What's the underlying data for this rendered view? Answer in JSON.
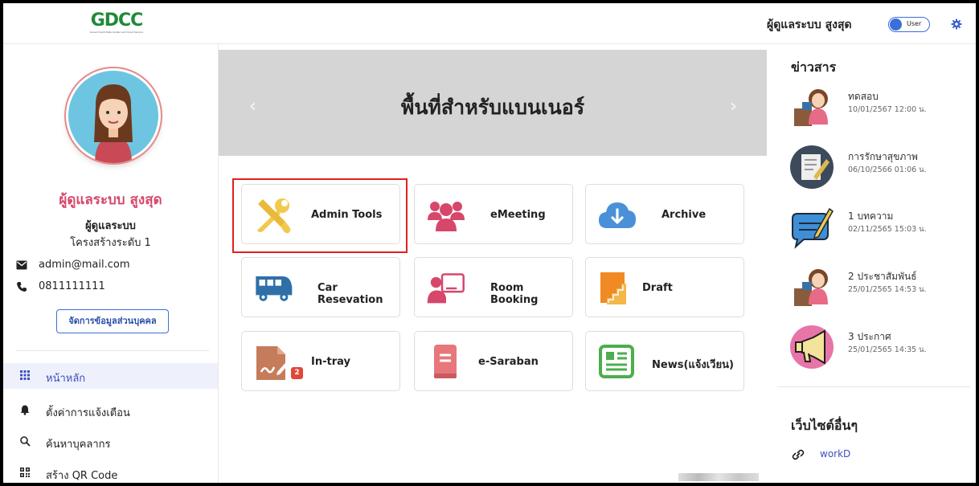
{
  "header": {
    "logo_text": "GDCC",
    "logo_subtext": "Government Data Center and Cloud Service",
    "user_name": "ผู้ดูแลระบบ สูงสุด",
    "mode_toggle_label": "User",
    "settings_icon": "gear-icon"
  },
  "profile": {
    "name": "ผู้ดูแลระบบ สูงสุด",
    "role": "ผู้ดูแลระบบ",
    "level": "โครงสร้างระดับ 1",
    "email": "admin@mail.com",
    "phone": "0811111111",
    "manage_button": "จัดการข้อมูลส่วนบุคคล"
  },
  "nav": {
    "items": [
      {
        "label": "หน้าหลัก",
        "icon": "grid-icon",
        "active": true
      },
      {
        "label": "ตั้งค่าการแจ้งเตือน",
        "icon": "bell-icon",
        "active": false
      },
      {
        "label": "ค้นหาบุคลากร",
        "icon": "search-icon",
        "active": false
      },
      {
        "label": "สร้าง QR Code",
        "icon": "qr-code-icon",
        "active": false
      }
    ]
  },
  "banner": {
    "title": "พื้นที่สำหรับแบนเนอร์",
    "prev": "‹",
    "next": "›"
  },
  "apps": {
    "items": [
      {
        "label": "Admin Tools",
        "icon": "tools-icon"
      },
      {
        "label": "eMeeting",
        "icon": "people-icon"
      },
      {
        "label": "Archive",
        "icon": "cloud-download-icon"
      },
      {
        "label": "Car Resevation",
        "icon": "bus-icon"
      },
      {
        "label": "Room Booking",
        "icon": "presentation-icon"
      },
      {
        "label": "Draft",
        "icon": "draft-icon"
      },
      {
        "label": "In-tray",
        "icon": "signature-icon",
        "badge": "2"
      },
      {
        "label": "e-Saraban",
        "icon": "document-icon"
      },
      {
        "label": "News(แจ้งเวียน)",
        "icon": "newspaper-icon"
      }
    ]
  },
  "news": {
    "title": "ข่าวสาร",
    "items": [
      {
        "title": "ทดสอบ",
        "date": "10/01/2567 12:00 น."
      },
      {
        "title": "การรักษาสุขภาพ",
        "date": "06/10/2566 01:06 น."
      },
      {
        "title": "1 บทความ",
        "date": "02/11/2565 15:03 น."
      },
      {
        "title": "2 ประชาสัมพันธ์",
        "date": "25/01/2565 14:53 น."
      },
      {
        "title": "3 ประกาศ",
        "date": "25/01/2565 14:35 น."
      }
    ]
  },
  "other_sites": {
    "title": "เว็บไซต์อื่นๆ",
    "items": [
      {
        "label": "workD"
      }
    ]
  },
  "colors": {
    "accent_blue": "#3b6fd8",
    "profile_name": "#d6476b",
    "active_nav_bg": "#eef0fb",
    "highlight_box": "#e02020"
  }
}
